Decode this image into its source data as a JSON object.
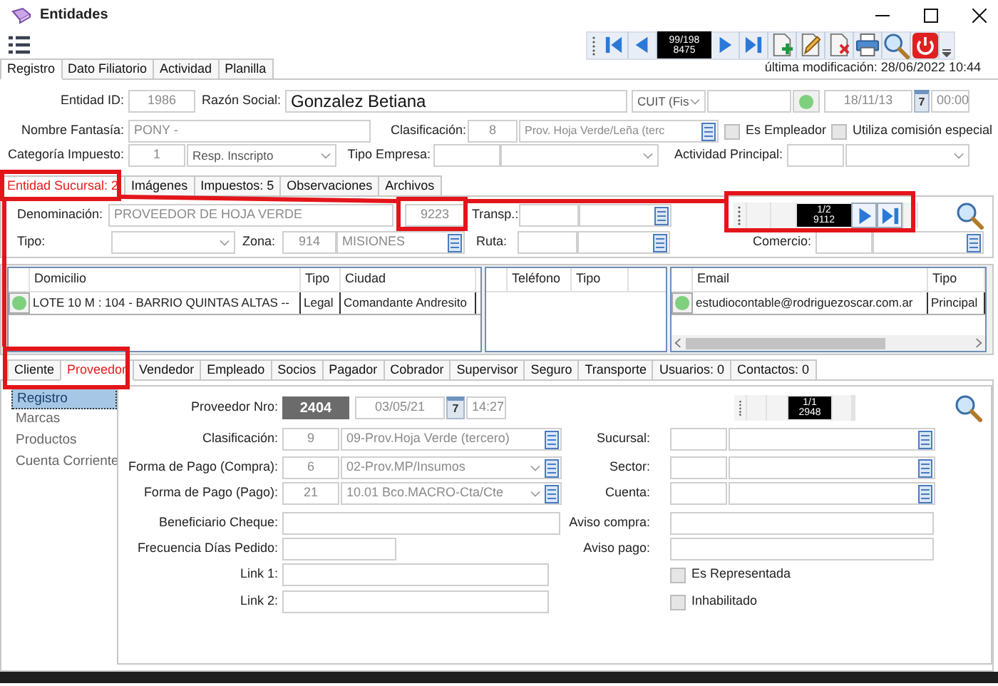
{
  "window": {
    "title": "Entidades"
  },
  "toolbar": {
    "position": "99/198",
    "record_id": "8475"
  },
  "main_tabs": [
    {
      "label": "Registro",
      "selected": true
    },
    {
      "label": "Dato Filiatorio",
      "selected": false
    },
    {
      "label": "Actividad",
      "selected": false
    },
    {
      "label": "Planilla",
      "selected": false
    }
  ],
  "last_modified": "última modificación: 28/06/2022 10:44",
  "header_rows": [
    [
      {
        "kind": "label",
        "text": "Entidad ID:"
      },
      {
        "kind": "input",
        "value": "1986"
      },
      {
        "kind": "label",
        "text": "Razón Social:"
      },
      {
        "kind": "input",
        "value": "Gonzalez Betiana"
      },
      {
        "kind": "combo",
        "value": "CUIT (Fis"
      },
      {
        "kind": "input"
      },
      {
        "kind": "status_button"
      },
      {
        "kind": "date",
        "value": "18/11/13"
      },
      {
        "kind": "calendar",
        "value": "7"
      },
      {
        "kind": "time",
        "value": "00:00"
      }
    ],
    [
      {
        "kind": "label",
        "text": "Nombre Fantasía:"
      },
      {
        "kind": "input",
        "value": "PONY -"
      },
      {
        "kind": "label",
        "text": "Clasificación:"
      },
      {
        "kind": "input",
        "value": "8"
      },
      {
        "kind": "lookup",
        "value": "Prov. Hoja Verde/Leña  (terc"
      },
      {
        "kind": "checkbox",
        "label": "Es Empleador",
        "checked": false
      },
      {
        "kind": "checkbox",
        "label": "Utiliza comisión especial",
        "checked": false
      }
    ],
    [
      {
        "kind": "label",
        "text": "Categoría Impuesto:"
      },
      {
        "kind": "input",
        "value": "1"
      },
      {
        "kind": "combo",
        "value": "Resp. Inscripto"
      },
      {
        "kind": "label",
        "text": "Tipo Empresa:"
      },
      {
        "kind": "input"
      },
      {
        "kind": "combo"
      },
      {
        "kind": "label",
        "text": "Actividad Principal:"
      },
      {
        "kind": "input"
      },
      {
        "kind": "combo"
      }
    ]
  ],
  "branch_tabs": [
    {
      "label": "Entidad Sucursal: 2",
      "selected": true,
      "highlighted": true
    },
    {
      "label": "Imágenes",
      "selected": false,
      "highlighted": false
    },
    {
      "label": "Impuestos: 5",
      "selected": false,
      "highlighted": false
    },
    {
      "label": "Observaciones",
      "selected": false,
      "highlighted": false
    },
    {
      "label": "Archivos",
      "selected": false,
      "highlighted": false
    }
  ],
  "branch_rows": [
    [
      {
        "kind": "label",
        "text": "Denominación:"
      },
      {
        "kind": "input",
        "value": "PROVEEDOR DE HOJA VERDE"
      },
      {
        "kind": "input",
        "value": "9223"
      },
      {
        "kind": "label",
        "text": "Transp.:"
      },
      {
        "kind": "input"
      },
      {
        "kind": "lookup"
      },
      {
        "kind": "navigator",
        "position": "1/2",
        "record_id": "9112",
        "can_advance": true
      },
      {
        "kind": "search"
      }
    ],
    [
      {
        "kind": "label",
        "text": "Tipo:"
      },
      {
        "kind": "combo"
      },
      {
        "kind": "label",
        "text": "Zona:"
      },
      {
        "kind": "input",
        "value": "914"
      },
      {
        "kind": "lookup",
        "value": "MISIONES"
      },
      {
        "kind": "label",
        "text": "Ruta:"
      },
      {
        "kind": "input"
      },
      {
        "kind": "lookup"
      },
      {
        "kind": "label",
        "text": "Comercio:"
      },
      {
        "kind": "input"
      },
      {
        "kind": "lookup"
      }
    ]
  ],
  "address_grid": {
    "columns": [
      "Domicilio",
      "Tipo",
      "Ciudad"
    ],
    "rows": [
      {
        "cells": [
          "LOTE 10 M : 104 - BARRIO QUINTAS ALTAS --",
          "Legal",
          "Comandante Andresito"
        ]
      }
    ]
  },
  "phone_grid": {
    "columns": [
      "Teléfono",
      "Tipo"
    ]
  },
  "email_grid": {
    "columns": [
      "Email",
      "Tipo"
    ],
    "rows": [
      {
        "cells": [
          "estudiocontable@rodriguezoscar.com.ar",
          "Principal"
        ]
      }
    ]
  },
  "role_tabs": [
    {
      "label": "Cliente",
      "selected": false,
      "highlighted": false
    },
    {
      "label": "Proveedor",
      "selected": true,
      "highlighted": true
    },
    {
      "label": "Vendedor",
      "selected": false,
      "highlighted": false
    },
    {
      "label": "Empleado",
      "selected": false,
      "highlighted": false
    },
    {
      "label": "Socios",
      "selected": false,
      "highlighted": false
    },
    {
      "label": "Pagador",
      "selected": false,
      "highlighted": false
    },
    {
      "label": "Cobrador",
      "selected": false,
      "highlighted": false
    },
    {
      "label": "Supervisor",
      "selected": false,
      "highlighted": false
    },
    {
      "label": "Seguro",
      "selected": false,
      "highlighted": false
    },
    {
      "label": "Transporte",
      "selected": false,
      "highlighted": false
    },
    {
      "label": "Usuarios: 0",
      "selected": false,
      "highlighted": false
    },
    {
      "label": "Contactos: 0",
      "selected": false,
      "highlighted": false
    }
  ],
  "provider_sections": [
    {
      "label": "Registro",
      "selected": true
    },
    {
      "label": "Marcas",
      "selected": false
    },
    {
      "label": "Productos",
      "selected": false
    },
    {
      "label": "Cuenta Corriente",
      "selected": false
    }
  ],
  "provider_rows": [
    [
      {
        "kind": "label",
        "text": "Proveedor Nro:"
      },
      {
        "kind": "badge",
        "value": "2404"
      },
      {
        "kind": "date",
        "value": "03/05/21"
      },
      {
        "kind": "calendar",
        "value": "7"
      },
      {
        "kind": "time",
        "value": "14:27"
      },
      {
        "kind": "navigator",
        "position": "1/1",
        "record_id": "2948",
        "can_advance": false
      },
      {
        "kind": "search"
      }
    ],
    [
      {
        "kind": "label",
        "text": "Clasificación:"
      },
      {
        "kind": "input",
        "value": "9"
      },
      {
        "kind": "lookup",
        "value": "09-Prov.Hoja Verde (tercero)"
      },
      {
        "kind": "label",
        "text": "Sucursal:"
      },
      {
        "kind": "input"
      },
      {
        "kind": "lookup"
      }
    ],
    [
      {
        "kind": "label",
        "text": "Forma de Pago (Compra):"
      },
      {
        "kind": "input",
        "value": "6"
      },
      {
        "kind": "combolookup",
        "value": "02-Prov.MP/Insumos"
      },
      {
        "kind": "label",
        "text": "Sector:"
      },
      {
        "kind": "input"
      },
      {
        "kind": "lookup"
      }
    ],
    [
      {
        "kind": "label",
        "text": "Forma de Pago (Pago):"
      },
      {
        "kind": "input",
        "value": "21"
      },
      {
        "kind": "combolookup",
        "value": "10.01 Bco.MACRO-Cta/Cte"
      },
      {
        "kind": "label",
        "text": "Cuenta:"
      },
      {
        "kind": "input"
      },
      {
        "kind": "lookup"
      }
    ],
    [
      {
        "kind": "label",
        "text": "Beneficiario Cheque:"
      },
      {
        "kind": "input"
      },
      {
        "kind": "label",
        "text": "Aviso compra:"
      },
      {
        "kind": "input"
      }
    ],
    [
      {
        "kind": "label",
        "text": "Frecuencia Días Pedido:"
      },
      {
        "kind": "input"
      },
      {
        "kind": "label",
        "text": "Aviso pago:"
      },
      {
        "kind": "input"
      }
    ],
    [
      {
        "kind": "label",
        "text": "Link 1:"
      },
      {
        "kind": "input"
      },
      {
        "kind": "checkbox",
        "label": "Es Representada",
        "checked": false
      }
    ],
    [
      {
        "kind": "label",
        "text": "Link 2:"
      },
      {
        "kind": "input"
      },
      {
        "kind": "checkbox",
        "label": "Inhabilitado",
        "checked": false
      }
    ]
  ]
}
